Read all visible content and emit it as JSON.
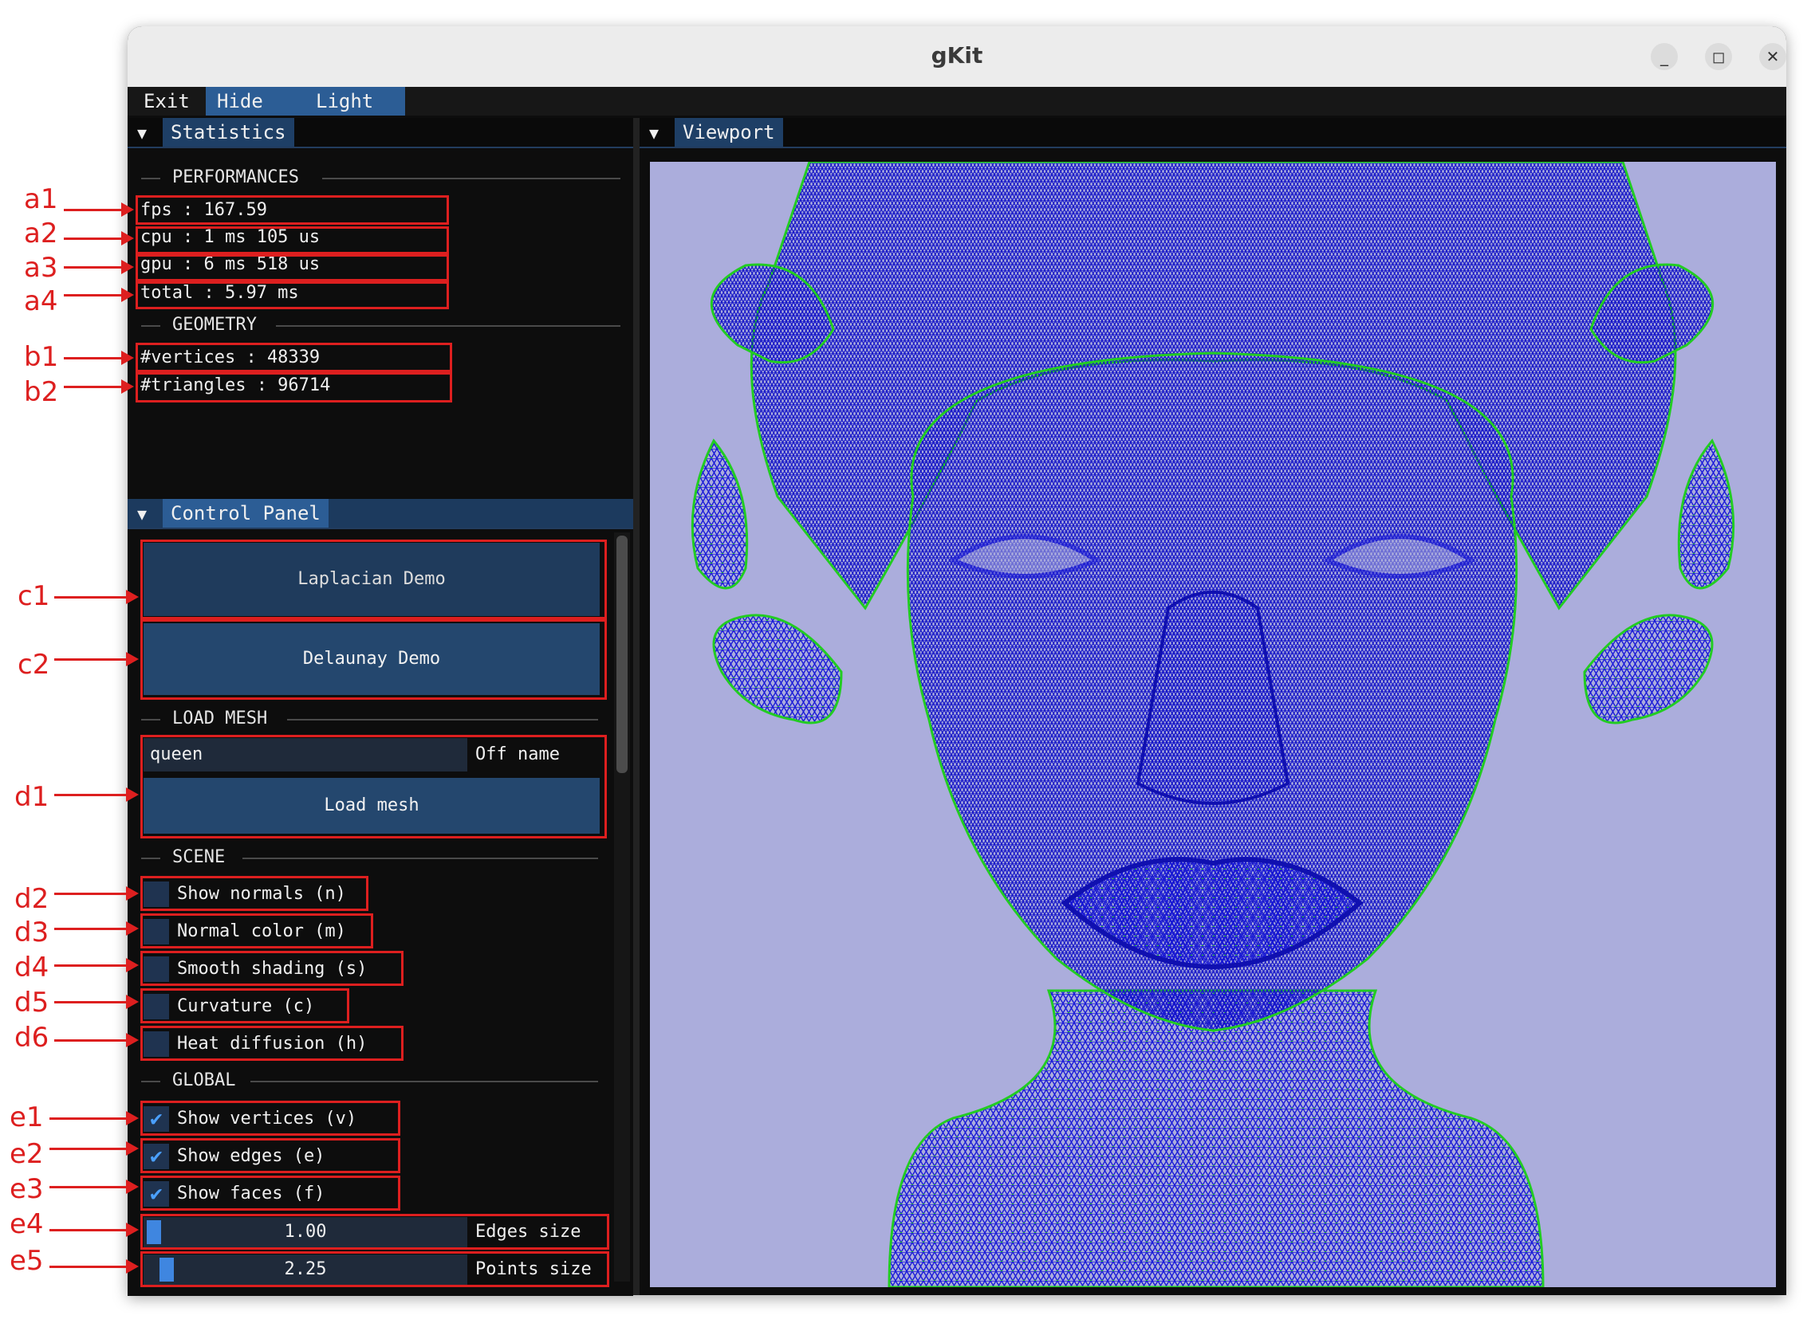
{
  "window": {
    "title": "gKit",
    "minimize": "_",
    "maximize": "◻",
    "close": "✕"
  },
  "menu": {
    "exit": "Exit",
    "hide_ui": "Hide UI (TAB)",
    "theme": "Light Theme"
  },
  "statistics": {
    "tab": "Statistics",
    "performances_header": "PERFORMANCES",
    "fps": "fps : 167.59",
    "cpu": "cpu : 1 ms 105 us",
    "gpu": "gpu : 6 ms 518 us",
    "total": "total : 5.97 ms",
    "geometry_header": "GEOMETRY",
    "vertices": "#vertices : 48339",
    "triangles": "#triangles : 96714"
  },
  "control_panel": {
    "tab": "Control Panel",
    "laplacian_button": "Laplacian Demo",
    "delaunay_button": "Delaunay Demo",
    "load_mesh_header": "LOAD MESH",
    "mesh_name_value": "queen",
    "mesh_name_label": "Off name",
    "load_button": "Load mesh",
    "scene_header": "SCENE",
    "scene_options": [
      {
        "label": "Show normals (n)",
        "checked": false
      },
      {
        "label": "Normal color (m)",
        "checked": false
      },
      {
        "label": "Smooth shading (s)",
        "checked": false
      },
      {
        "label": "Curvature (c)",
        "checked": false
      },
      {
        "label": "Heat diffusion (h)",
        "checked": false
      }
    ],
    "global_header": "GLOBAL",
    "global_options": [
      {
        "label": "Show vertices (v)",
        "checked": true
      },
      {
        "label": "Show edges (e)",
        "checked": true
      },
      {
        "label": "Show faces (f)",
        "checked": true
      }
    ],
    "edges_size": {
      "value": "1.00",
      "label": "Edges size",
      "fraction": 0.0
    },
    "points_size": {
      "value": "2.25",
      "label": "Points size",
      "fraction": 0.04
    },
    "checkmark": "✔"
  },
  "viewport": {
    "tab": "Viewport"
  },
  "annotations": [
    "a1",
    "a2",
    "a3",
    "a4",
    "b1",
    "b2",
    "c1",
    "c2",
    "d1",
    "d2",
    "d3",
    "d4",
    "d5",
    "d6",
    "e1",
    "e2",
    "e3",
    "e4",
    "e5"
  ],
  "colors": {
    "annotation": "#dd1f1f",
    "mesh_edges": "#1a1ad8",
    "mesh_vertices": "#22cc22",
    "viewport_bg": "#abaddc",
    "accent": "#2c5d95"
  }
}
